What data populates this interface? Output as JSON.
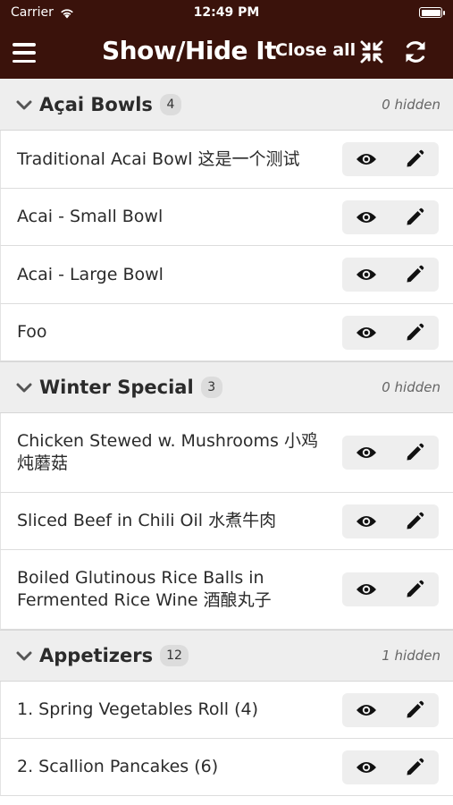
{
  "status": {
    "carrier": "Carrier",
    "time": "12:49 PM"
  },
  "nav": {
    "title": "Show/Hide It",
    "close_all": "Close all"
  },
  "icons": {
    "menu": "menu-icon",
    "collapse": "collapse-arrows-icon",
    "refresh": "refresh-icon",
    "eye": "eye-icon",
    "edit": "pencil-icon",
    "chevron": "chevron-down-icon"
  },
  "colors": {
    "header_bg": "#3a120b",
    "section_bg": "#eeeeee",
    "action_bg": "#eeeeee"
  },
  "sections": [
    {
      "title": "Açai Bowls",
      "count": "4",
      "hidden": "0 hidden",
      "items": [
        {
          "label": "Traditional Acai Bowl 这是一个测试"
        },
        {
          "label": "Acai - Small Bowl"
        },
        {
          "label": "Acai - Large Bowl"
        },
        {
          "label": "Foo"
        }
      ]
    },
    {
      "title": "Winter Special",
      "count": "3",
      "hidden": "0 hidden",
      "items": [
        {
          "label": "Chicken Stewed w. Mushrooms 小鸡炖蘑菇"
        },
        {
          "label": "Sliced Beef in Chili Oil 水煮牛肉"
        },
        {
          "label": "Boiled Glutinous Rice Balls in Fermented Rice Wine 酒酿丸子"
        }
      ]
    },
    {
      "title": "Appetizers",
      "count": "12",
      "hidden": "1 hidden",
      "items": [
        {
          "label": "1. Spring Vegetables Roll (4)"
        },
        {
          "label": "2. Scallion Pancakes (6)"
        }
      ]
    }
  ]
}
